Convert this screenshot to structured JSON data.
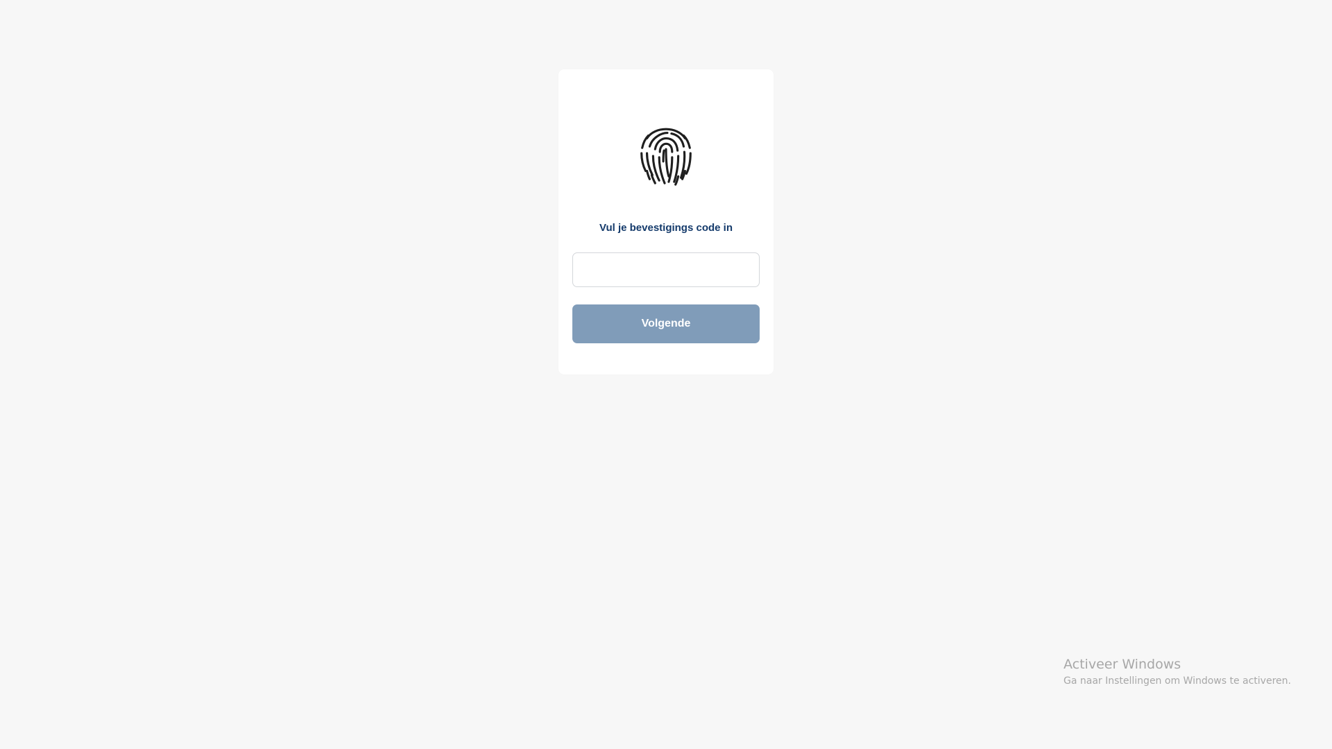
{
  "login": {
    "icon": "fingerprint-icon",
    "heading": "Vul je bevestigings code in",
    "code_input": {
      "value": "",
      "placeholder": ""
    },
    "next_label": "Volgende",
    "colors": {
      "heading": "#143a6b",
      "button_bg": "#809cb9",
      "page_bg": "#f7f7f7"
    }
  },
  "windows_watermark": {
    "title": "Activeer Windows",
    "subtitle": "Ga naar Instellingen om Windows te activeren."
  }
}
